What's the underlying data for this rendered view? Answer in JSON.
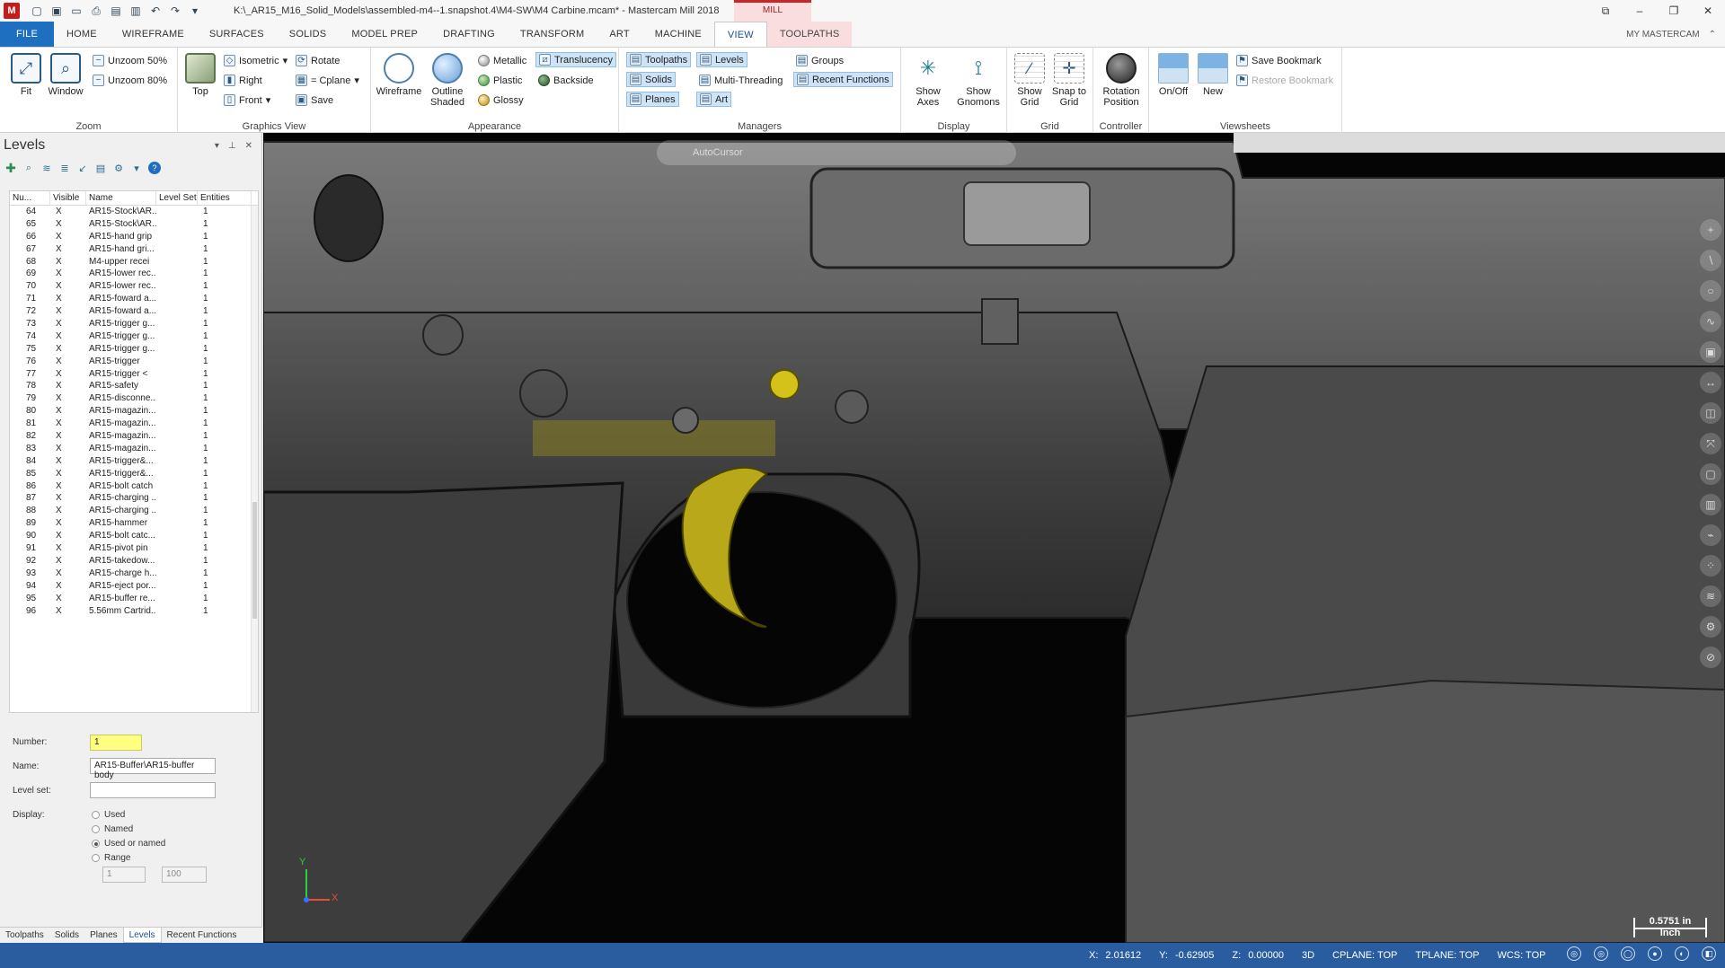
{
  "window": {
    "title": "K:\\_AR15_M16_Solid_Models\\assembled-m4--1.snapshot.4\\M4-SW\\M4 Carbine.mcam* - Mastercam Mill 2018",
    "context_tab": "MILL",
    "my_mastercam": "MY MASTERCAM"
  },
  "tabs": [
    "FILE",
    "HOME",
    "WIREFRAME",
    "SURFACES",
    "SOLIDS",
    "MODEL PREP",
    "DRAFTING",
    "TRANSFORM",
    "ART",
    "MACHINE",
    "VIEW",
    "TOOLPATHS"
  ],
  "active_tab": "VIEW",
  "ribbon": {
    "zoom": {
      "label": "Zoom",
      "fit": "Fit",
      "window": "Window",
      "unzoom50": "Unzoom 50%",
      "unzoom80": "Unzoom 80%"
    },
    "graphics_view": {
      "label": "Graphics View",
      "top": "Top",
      "isometric": "Isometric",
      "right": "Right",
      "front": "Front",
      "rotate": "Rotate",
      "cplane": "= Cplane",
      "save": "Save"
    },
    "appearance": {
      "label": "Appearance",
      "wireframe": "Wireframe",
      "outline_shaded": "Outline Shaded",
      "metallic": "Metallic",
      "plastic": "Plastic",
      "glossy": "Glossy",
      "translucency": "Translucency",
      "backside": "Backside"
    },
    "managers": {
      "label": "Managers",
      "toolpaths": "Toolpaths",
      "solids": "Solids",
      "planes": "Planes",
      "levels": "Levels",
      "multi_threading": "Multi-Threading",
      "art": "Art",
      "groups": "Groups",
      "recent_functions": "Recent Functions"
    },
    "display": {
      "label": "Display",
      "show_axes": "Show Axes",
      "show_gnomons": "Show Gnomons"
    },
    "grid": {
      "label": "Grid",
      "show_grid": "Show Grid",
      "snap_to_grid": "Snap to Grid"
    },
    "controller": {
      "label": "Controller",
      "rotation_position": "Rotation Position"
    },
    "viewsheets": {
      "label": "Viewsheets",
      "on_off": "On/Off",
      "new": "New",
      "save_bookmark": "Save Bookmark",
      "restore_bookmark": "Restore Bookmark"
    }
  },
  "levels_panel": {
    "title": "Levels",
    "columns": [
      "Nu...",
      "Visible",
      "Name",
      "Level Set",
      "Entities"
    ],
    "rows": [
      {
        "num": "64",
        "visible": "X",
        "name": "AR15-Stock\\AR...",
        "set": "",
        "entities": "1"
      },
      {
        "num": "65",
        "visible": "X",
        "name": "AR15-Stock\\AR...",
        "set": "",
        "entities": "1"
      },
      {
        "num": "66",
        "visible": "X",
        "name": "AR15-hand grip",
        "set": "",
        "entities": "1"
      },
      {
        "num": "67",
        "visible": "X",
        "name": "AR15-hand gri...",
        "set": "",
        "entities": "1"
      },
      {
        "num": "68",
        "visible": "X",
        "name": "M4-upper recei",
        "set": "",
        "entities": "1"
      },
      {
        "num": "69",
        "visible": "X",
        "name": "AR15-lower rec...",
        "set": "",
        "entities": "1"
      },
      {
        "num": "70",
        "visible": "X",
        "name": "AR15-lower rec...",
        "set": "",
        "entities": "1"
      },
      {
        "num": "71",
        "visible": "X",
        "name": "AR15-foward a...",
        "set": "",
        "entities": "1"
      },
      {
        "num": "72",
        "visible": "X",
        "name": "AR15-foward a...",
        "set": "",
        "entities": "1"
      },
      {
        "num": "73",
        "visible": "X",
        "name": "AR15-trigger g...",
        "set": "",
        "entities": "1"
      },
      {
        "num": "74",
        "visible": "X",
        "name": "AR15-trigger g...",
        "set": "",
        "entities": "1"
      },
      {
        "num": "75",
        "visible": "X",
        "name": "AR15-trigger g...",
        "set": "",
        "entities": "1"
      },
      {
        "num": "76",
        "visible": "X",
        "name": "AR15-trigger",
        "set": "",
        "entities": "1"
      },
      {
        "num": "77",
        "visible": "X",
        "name": "AR15-trigger <",
        "set": "",
        "entities": "1"
      },
      {
        "num": "78",
        "visible": "X",
        "name": "AR15-safety",
        "set": "",
        "entities": "1"
      },
      {
        "num": "79",
        "visible": "X",
        "name": "AR15-disconne...",
        "set": "",
        "entities": "1"
      },
      {
        "num": "80",
        "visible": "X",
        "name": "AR15-magazin...",
        "set": "",
        "entities": "1"
      },
      {
        "num": "81",
        "visible": "X",
        "name": "AR15-magazin...",
        "set": "",
        "entities": "1"
      },
      {
        "num": "82",
        "visible": "X",
        "name": "AR15-magazin...",
        "set": "",
        "entities": "1"
      },
      {
        "num": "83",
        "visible": "X",
        "name": "AR15-magazin...",
        "set": "",
        "entities": "1"
      },
      {
        "num": "84",
        "visible": "X",
        "name": "AR15-trigger&...",
        "set": "",
        "entities": "1"
      },
      {
        "num": "85",
        "visible": "X",
        "name": "AR15-trigger&...",
        "set": "",
        "entities": "1"
      },
      {
        "num": "86",
        "visible": "X",
        "name": "AR15-bolt catch",
        "set": "",
        "entities": "1"
      },
      {
        "num": "87",
        "visible": "X",
        "name": "AR15-charging ...",
        "set": "",
        "entities": "1"
      },
      {
        "num": "88",
        "visible": "X",
        "name": "AR15-charging ...",
        "set": "",
        "entities": "1"
      },
      {
        "num": "89",
        "visible": "X",
        "name": "AR15-hammer",
        "set": "",
        "entities": "1"
      },
      {
        "num": "90",
        "visible": "X",
        "name": "AR15-bolt catc...",
        "set": "",
        "entities": "1"
      },
      {
        "num": "91",
        "visible": "X",
        "name": "AR15-pivot pin",
        "set": "",
        "entities": "1"
      },
      {
        "num": "92",
        "visible": "X",
        "name": "AR15-takedow...",
        "set": "",
        "entities": "1"
      },
      {
        "num": "93",
        "visible": "X",
        "name": "AR15-charge h...",
        "set": "",
        "entities": "1"
      },
      {
        "num": "94",
        "visible": "X",
        "name": "AR15-eject por...",
        "set": "",
        "entities": "1"
      },
      {
        "num": "95",
        "visible": "X",
        "name": "AR15-buffer re...",
        "set": "",
        "entities": "1"
      },
      {
        "num": "96",
        "visible": "X",
        "name": "5.56mm Cartrid...",
        "set": "",
        "entities": "1"
      }
    ],
    "number_label": "Number:",
    "number_value": "1",
    "name_label": "Name:",
    "name_value": "AR15-Buffer\\AR15-buffer body",
    "level_set_label": "Level set:",
    "level_set_value": "",
    "display_label": "Display:",
    "display_options": [
      "Used",
      "Named",
      "Used or named",
      "Range"
    ],
    "display_selected": "Used or named",
    "range_from": "1",
    "range_to": "100",
    "bottom_tabs": [
      "Toolpaths",
      "Solids",
      "Planes",
      "Levels",
      "Recent Functions"
    ],
    "active_bottom_tab": "Levels"
  },
  "viewport": {
    "autocursor": "AutoCursor",
    "scale_value": "0.5751 in",
    "scale_unit": "Inch",
    "triad_x": "X",
    "triad_y": "Y"
  },
  "statusbar": {
    "x_label": "X:",
    "x_value": "2.01612",
    "y_label": "Y:",
    "y_value": "-0.62905",
    "z_label": "Z:",
    "z_value": "0.00000",
    "mode": "3D",
    "cplane": "CPLANE: TOP",
    "tplane": "TPLANE: TOP",
    "wcs": "WCS: TOP"
  },
  "colors": {
    "file_tab": "#1e6fbf",
    "status_bar": "#2a5d9f",
    "highlight_yellow": "#ffff80",
    "selected_part": "#b8a81a"
  }
}
